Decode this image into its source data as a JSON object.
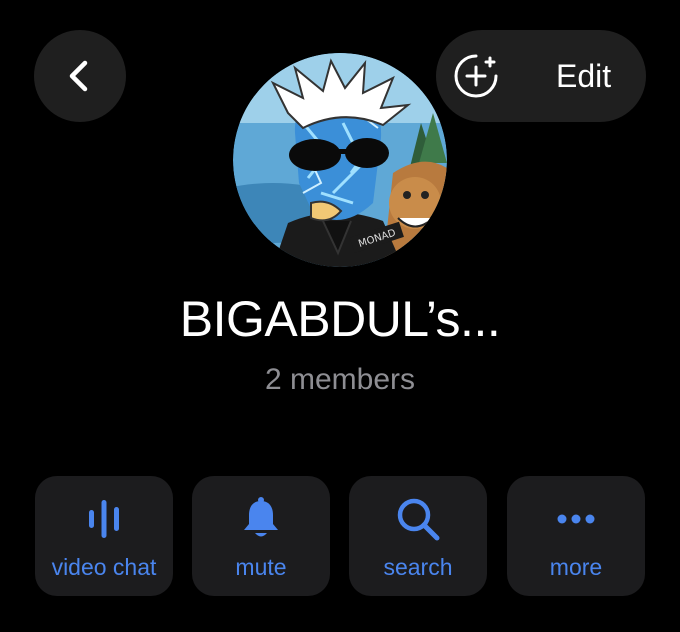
{
  "header": {
    "back_icon": "chevron-left-icon",
    "add_icon": "add-member-circle-icon",
    "edit_label": "Edit"
  },
  "group": {
    "avatar": "group-avatar-image",
    "avatar_text": "MONAD",
    "title": "BIGABDUL’s...",
    "members": "2 members"
  },
  "actions": [
    {
      "label": "video chat",
      "icon": "audio-wave-icon"
    },
    {
      "label": "mute",
      "icon": "bell-icon"
    },
    {
      "label": "search",
      "icon": "magnifier-icon"
    },
    {
      "label": "more",
      "icon": "ellipsis-icon"
    }
  ],
  "colors": {
    "background": "#000000",
    "surface": "#1c1c1e",
    "accent": "#4a85ee",
    "secondary_text": "#8e8e93"
  }
}
